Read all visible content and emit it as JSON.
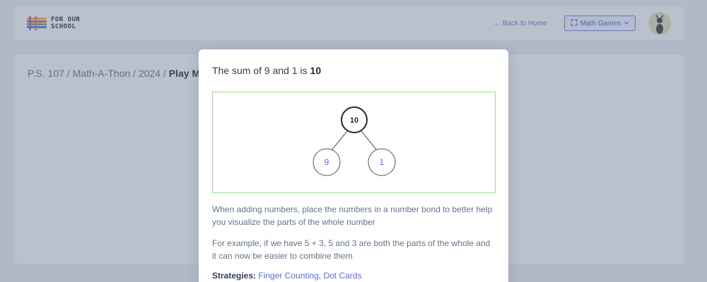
{
  "header": {
    "logo_text_line1": "For Our",
    "logo_text_line2": "School",
    "back_link": "← Back to Home",
    "games_button": "Math Games"
  },
  "breadcrumb": {
    "segments": [
      "P.S. 107",
      "Math-A-Thon",
      "2024"
    ],
    "current": "Play M"
  },
  "modal": {
    "title_prefix": "The sum of 9 and 1 is",
    "title_answer": "10",
    "bond": {
      "whole": "10",
      "part_left": "9",
      "part_right": "1"
    },
    "paragraph1": "When adding numbers, place the numbers in a number bond to better help you visualize the parts of the whole number",
    "paragraph2": "For example, if we have 5 + 3, 5 and 3 are both the parts of the whole and it can now be easier to combine them",
    "strategies_label": "Strategies:",
    "strategy_links": [
      "Finger Counting",
      "Dot Cards"
    ]
  },
  "colors": {
    "accent": "#5b6be0",
    "bond_border": "#9bdc8f"
  }
}
